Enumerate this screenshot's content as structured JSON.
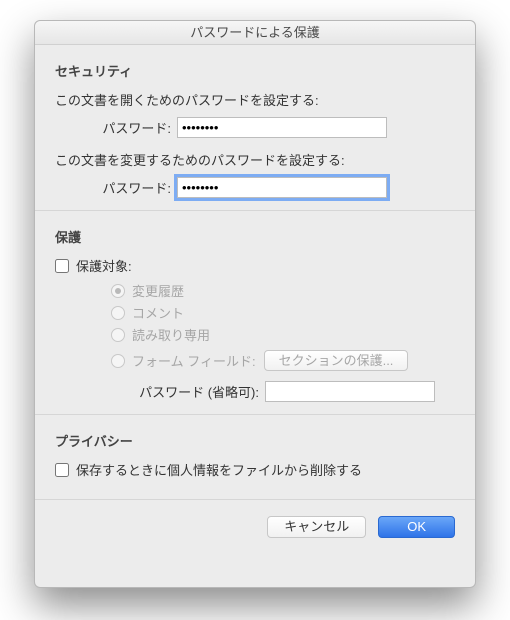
{
  "title": "パスワードによる保護",
  "security": {
    "heading": "セキュリティ",
    "open_desc": "この文書を開くためのパスワードを設定する:",
    "open_label": "パスワード:",
    "open_value": "••••••••",
    "modify_desc": "この文書を変更するためのパスワードを設定する:",
    "modify_label": "パスワード:",
    "modify_value": "••••••••"
  },
  "protection": {
    "heading": "保護",
    "target_label": "保護対象:",
    "radios": {
      "tracked_changes": "変更履歴",
      "comments": "コメント",
      "read_only": "読み取り専用",
      "form_fields": "フォーム フィールド:"
    },
    "sections_button": "セクションの保護...",
    "optional_pw_label": "パスワード (省略可):",
    "optional_pw_value": ""
  },
  "privacy": {
    "heading": "プライバシー",
    "remove_personal_info": "保存するときに個人情報をファイルから削除する"
  },
  "buttons": {
    "cancel": "キャンセル",
    "ok": "OK"
  }
}
